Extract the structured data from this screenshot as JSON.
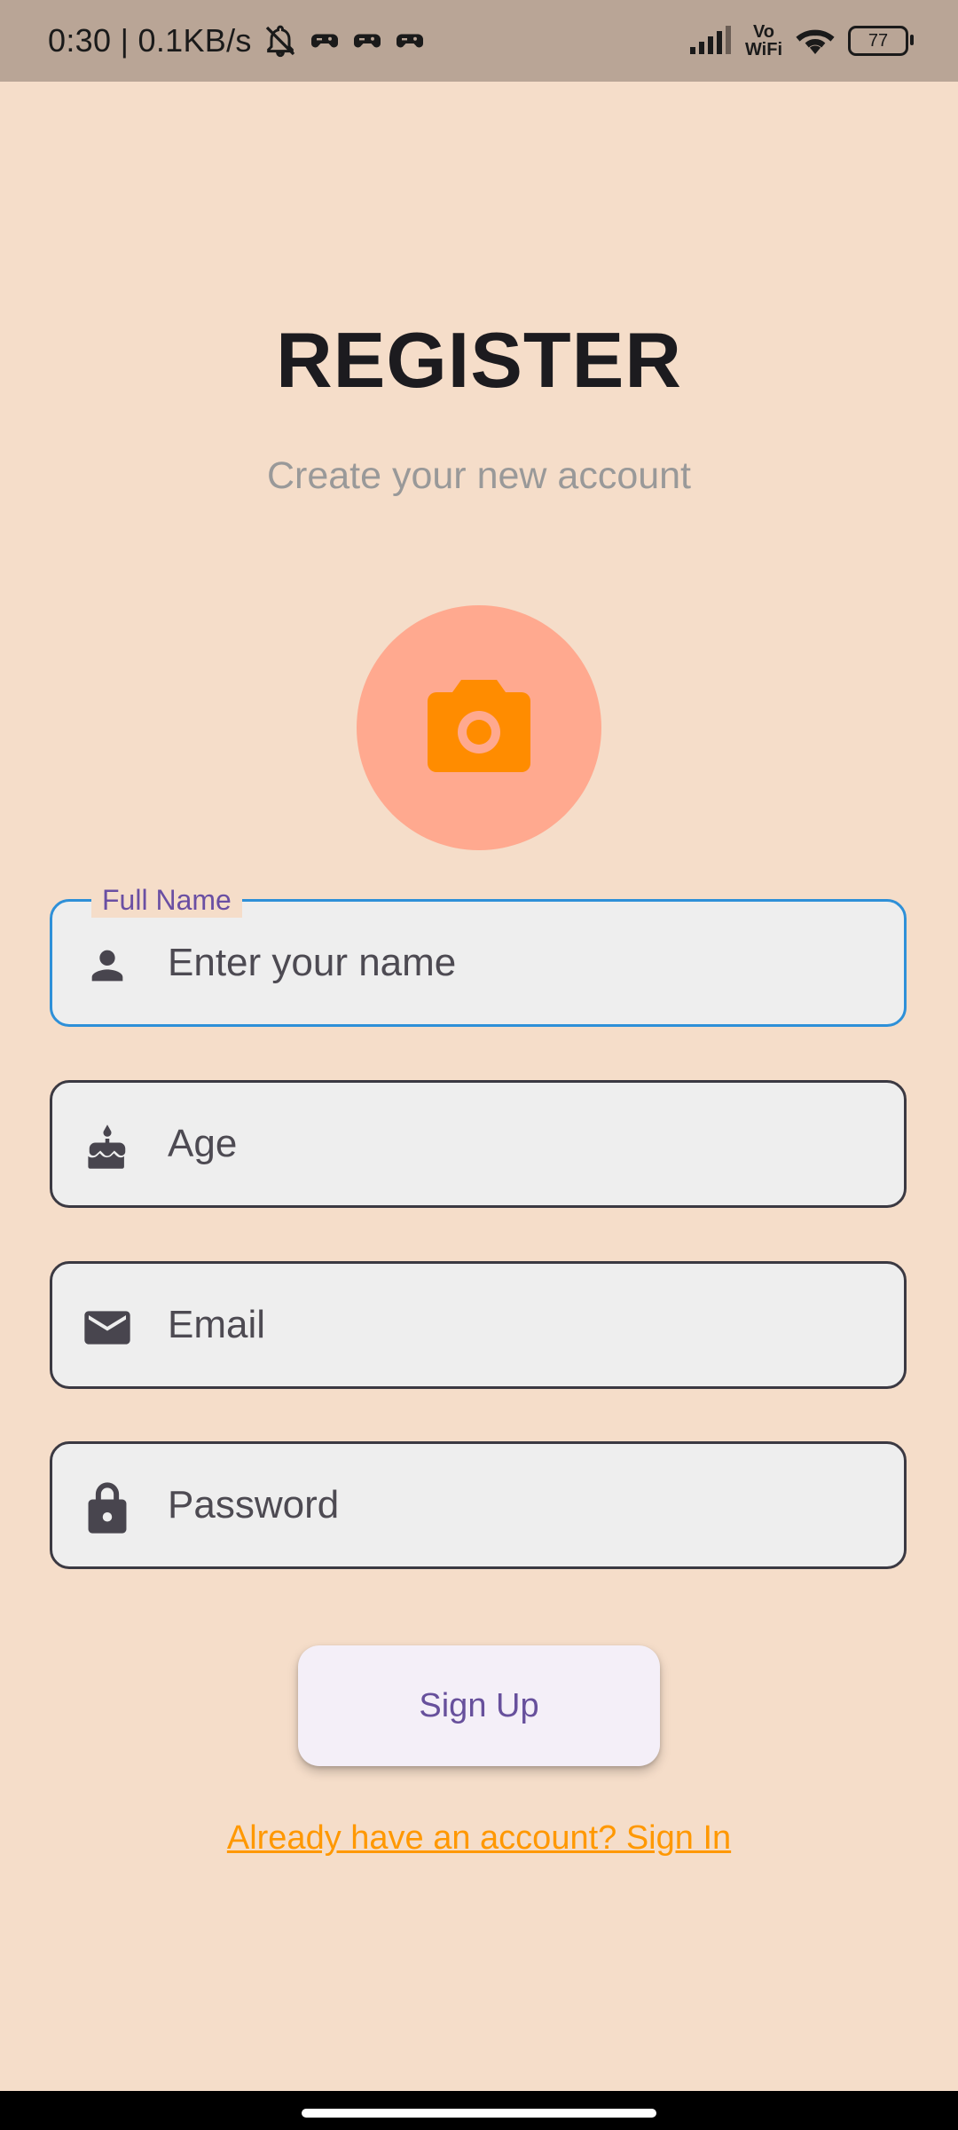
{
  "status_bar": {
    "time_speed": "0:30 | 0.1KB/s",
    "icons": [
      "bell-off-icon",
      "game-controller-icon",
      "game-controller-icon",
      "game-controller-icon"
    ],
    "vowifi_top": "Vo",
    "vowifi_bottom": "WiFi",
    "battery": "77"
  },
  "header": {
    "title": "REGISTER",
    "subtitle": "Create your new account"
  },
  "avatar": {
    "icon": "camera-icon",
    "bg_color": "#FFA98F",
    "icon_color": "#FF8C00"
  },
  "form": {
    "full_name": {
      "label": "Full Name",
      "placeholder": "Enter your name",
      "value": "",
      "icon": "person-icon"
    },
    "age": {
      "placeholder": "Age",
      "value": "",
      "icon": "cake-icon"
    },
    "email": {
      "placeholder": "Email",
      "value": "",
      "icon": "mail-icon"
    },
    "password": {
      "placeholder": "Password",
      "value": "",
      "icon": "lock-icon"
    }
  },
  "actions": {
    "signup_label": "Sign Up",
    "signin_link": "Already have an account? Sign In"
  },
  "colors": {
    "background": "#F5DDC9",
    "focus_border": "#2E90D8",
    "accent": "#67509C",
    "link": "#FF9800"
  }
}
